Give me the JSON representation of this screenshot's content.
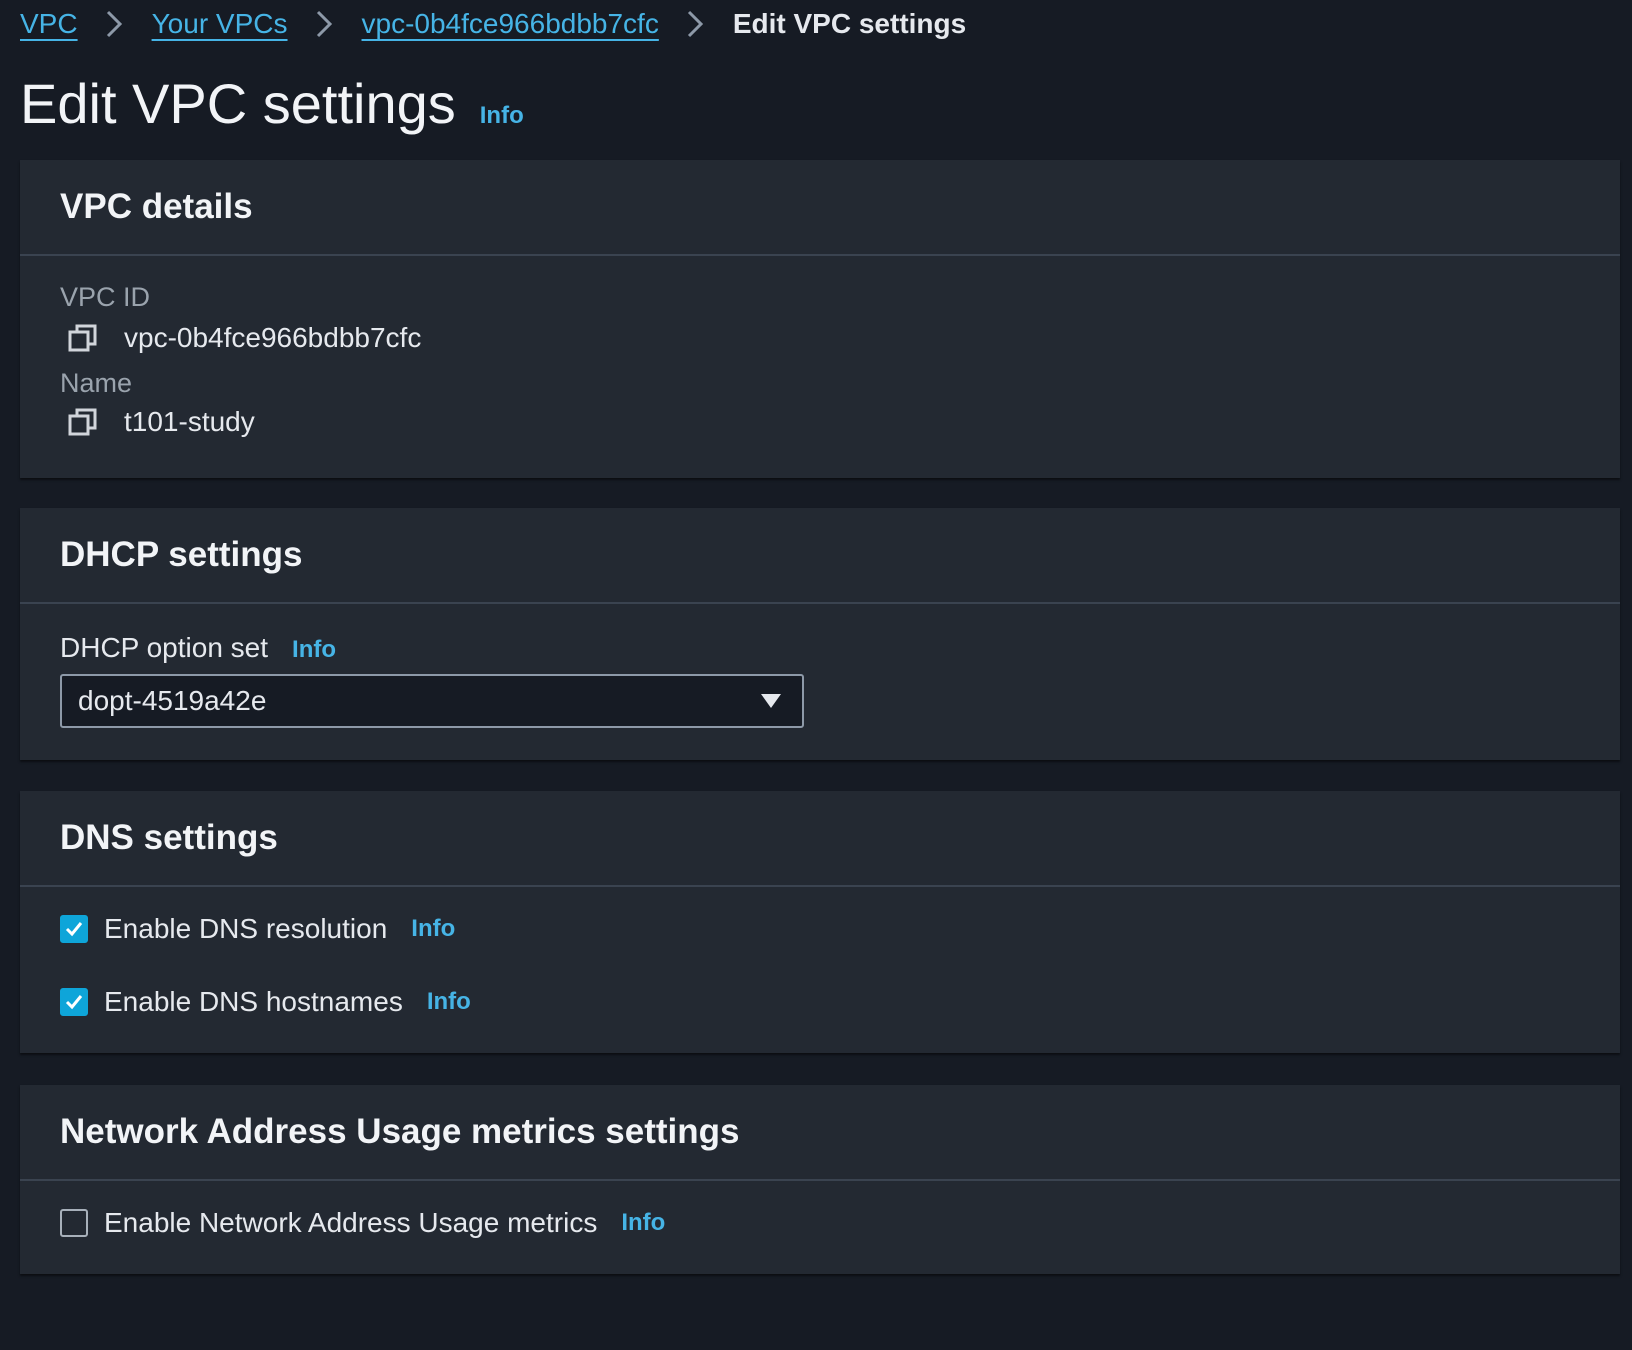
{
  "breadcrumb": {
    "items": [
      "VPC",
      "Your VPCs",
      "vpc-0b4fce966bdbb7cfc"
    ],
    "current": "Edit VPC settings"
  },
  "page": {
    "title": "Edit VPC settings",
    "info": "Info"
  },
  "vpc_details": {
    "title": "VPC details",
    "vpc_id_label": "VPC ID",
    "vpc_id_value": "vpc-0b4fce966bdbb7cfc",
    "name_label": "Name",
    "name_value": "t101-study"
  },
  "dhcp": {
    "title": "DHCP settings",
    "option_set_label": "DHCP option set",
    "info": "Info",
    "selected": "dopt-4519a42e"
  },
  "dns": {
    "title": "DNS settings",
    "resolution_label": "Enable DNS resolution",
    "resolution_checked": true,
    "hostnames_label": "Enable DNS hostnames",
    "hostnames_checked": true,
    "info": "Info"
  },
  "nau": {
    "title": "Network Address Usage metrics settings",
    "enable_label": "Enable Network Address Usage metrics",
    "enable_checked": false,
    "info": "Info"
  },
  "colors": {
    "background": "#161b24",
    "panel": "#232932",
    "link": "#46b4e6",
    "checkbox_checked": "#0ea5d9"
  }
}
